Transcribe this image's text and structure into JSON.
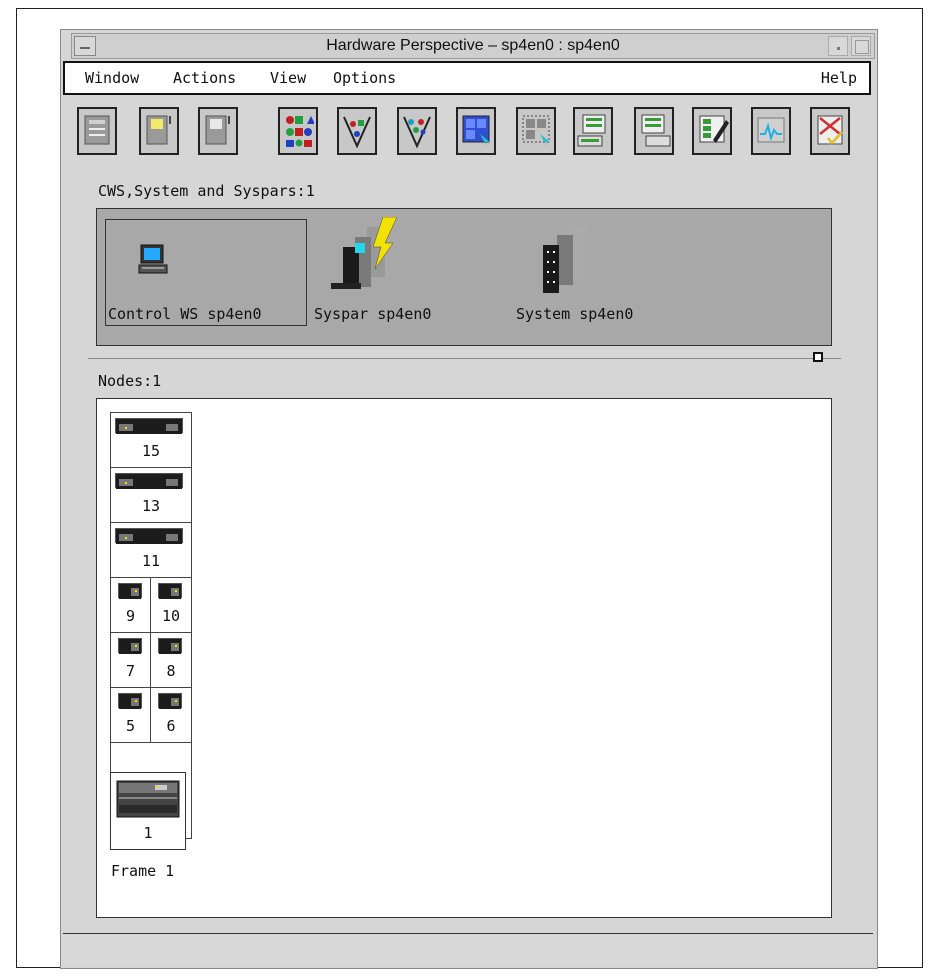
{
  "window": {
    "title": "Hardware Perspective – sp4en0 : sp4en0"
  },
  "menubar": {
    "items": [
      "Window",
      "Actions",
      "View",
      "Options"
    ],
    "help": "Help"
  },
  "toolbar": {
    "buttons": [
      "notebook-icon",
      "notebook-light-icon",
      "notebook-dim-icon",
      "shapes-grid-icon",
      "shapes-filter-icon",
      "shapes-funnel-icon",
      "select-all-icon",
      "deselect-icon",
      "panel-up-icon",
      "panel-down-icon",
      "table-edit-icon",
      "monitor-icon",
      "clear-delete-icon"
    ]
  },
  "cws_section": {
    "label": "CWS,System and Syspars:1",
    "items": [
      {
        "label": "Control WS sp4en0",
        "icon": "workstation-icon"
      },
      {
        "label": "Syspar sp4en0",
        "icon": "syspar-buildings-lightning-icon"
      },
      {
        "label": "System sp4en0",
        "icon": "system-buildings-icon"
      }
    ]
  },
  "nodes_section": {
    "label": "Nodes:1",
    "wide_nodes": [
      "15",
      "13",
      "11"
    ],
    "half_nodes": [
      [
        "9",
        "10"
      ],
      [
        "7",
        "8"
      ],
      [
        "5",
        "6"
      ]
    ],
    "frame_tile_number": "1",
    "frame_label": "Frame 1"
  },
  "colors": {
    "window_bg": "#d6d6d6",
    "pane_bg": "#a8a8a8",
    "lightning": "#f2e200",
    "screen": "#26a8ff"
  }
}
